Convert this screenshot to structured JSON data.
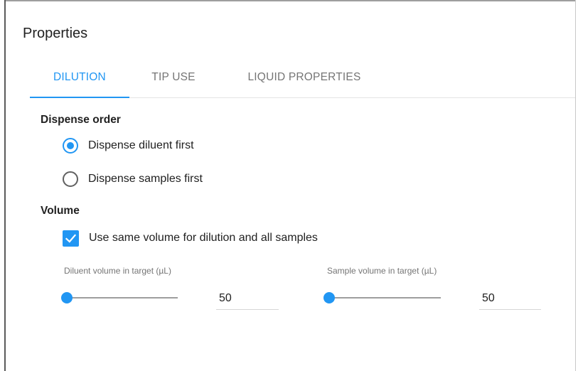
{
  "panel": {
    "title": "Properties"
  },
  "tabs": [
    {
      "label": "DILUTION",
      "active": true
    },
    {
      "label": "TIP USE",
      "active": false
    },
    {
      "label": "LIQUID PROPERTIES",
      "active": false
    }
  ],
  "dispense_order": {
    "heading": "Dispense order",
    "options": [
      {
        "label": "Dispense diluent first",
        "selected": true
      },
      {
        "label": "Dispense samples first",
        "selected": false
      }
    ]
  },
  "volume": {
    "heading": "Volume",
    "same_volume": {
      "label": "Use same volume for dilution and all samples",
      "checked": true
    },
    "diluent": {
      "label": "Diluent volume in target (µL)",
      "value": "50",
      "slider_fraction": 0.0
    },
    "sample": {
      "label": "Sample volume in target (µL)",
      "value": "50",
      "slider_fraction": 0.0
    }
  },
  "colors": {
    "accent": "#2196f3",
    "text": "#212121",
    "muted": "#757575"
  }
}
